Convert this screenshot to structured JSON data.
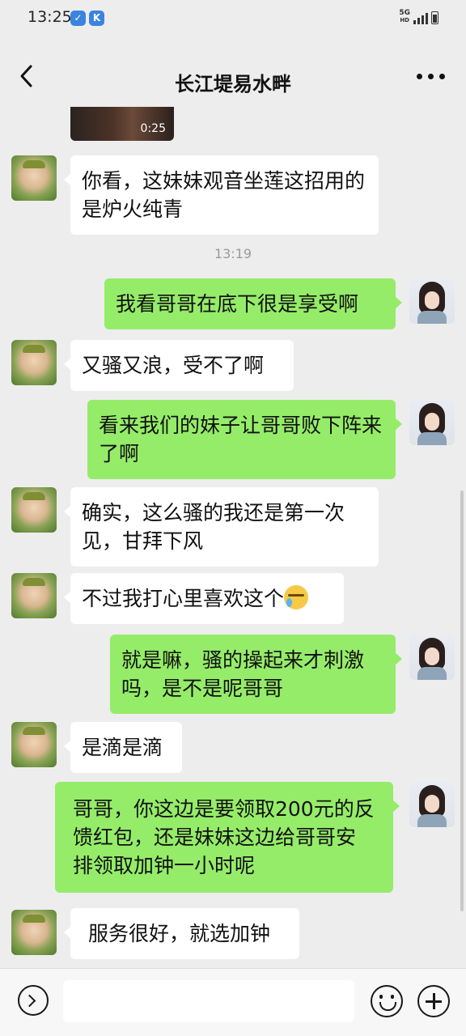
{
  "status_bar": {
    "time": "13:25",
    "app_icons": [
      "app-notification-icon",
      "app-k-icon"
    ],
    "network_label_top": "5G",
    "network_label_bottom": "HD"
  },
  "header": {
    "title": "长江堤易水畔",
    "icons": {
      "back": "chevron-left-icon",
      "more": "more-dots-icon"
    }
  },
  "video_message": {
    "duration": "0:25"
  },
  "timestamp": "13:19",
  "messages": [
    {
      "side": "left",
      "text": "你看，这妹妹观音坐莲这招用的是炉火纯青"
    },
    {
      "side": "right",
      "text": "我看哥哥在底下很是享受啊"
    },
    {
      "side": "left",
      "text": "又骚又浪，受不了啊"
    },
    {
      "side": "right",
      "text": "看来我们的妹子让哥哥败下阵来了啊"
    },
    {
      "side": "left",
      "text": "确实，这么骚的我还是第一次见，甘拜下风"
    },
    {
      "side": "left",
      "text": "不过我打心里喜欢这个",
      "emoji": "crying-face-emoji"
    },
    {
      "side": "right",
      "text": "就是嘛，骚的操起来才刺激吗，是不是呢哥哥"
    },
    {
      "side": "left",
      "text": "是滴是滴"
    },
    {
      "side": "right",
      "text": "哥哥，你这边是要领取200元的反馈红包，还是妹妹这边给哥哥安排领取加钟一小时呢"
    },
    {
      "side": "left",
      "text": "服务很好，就选加钟"
    }
  ],
  "input_bar": {
    "icons": {
      "voice": "voice-icon",
      "emoji": "emoji-icon",
      "plus": "plus-icon"
    }
  },
  "colors": {
    "background": "#ededed",
    "bubble_right": "#95ec69",
    "bubble_left": "#ffffff"
  }
}
